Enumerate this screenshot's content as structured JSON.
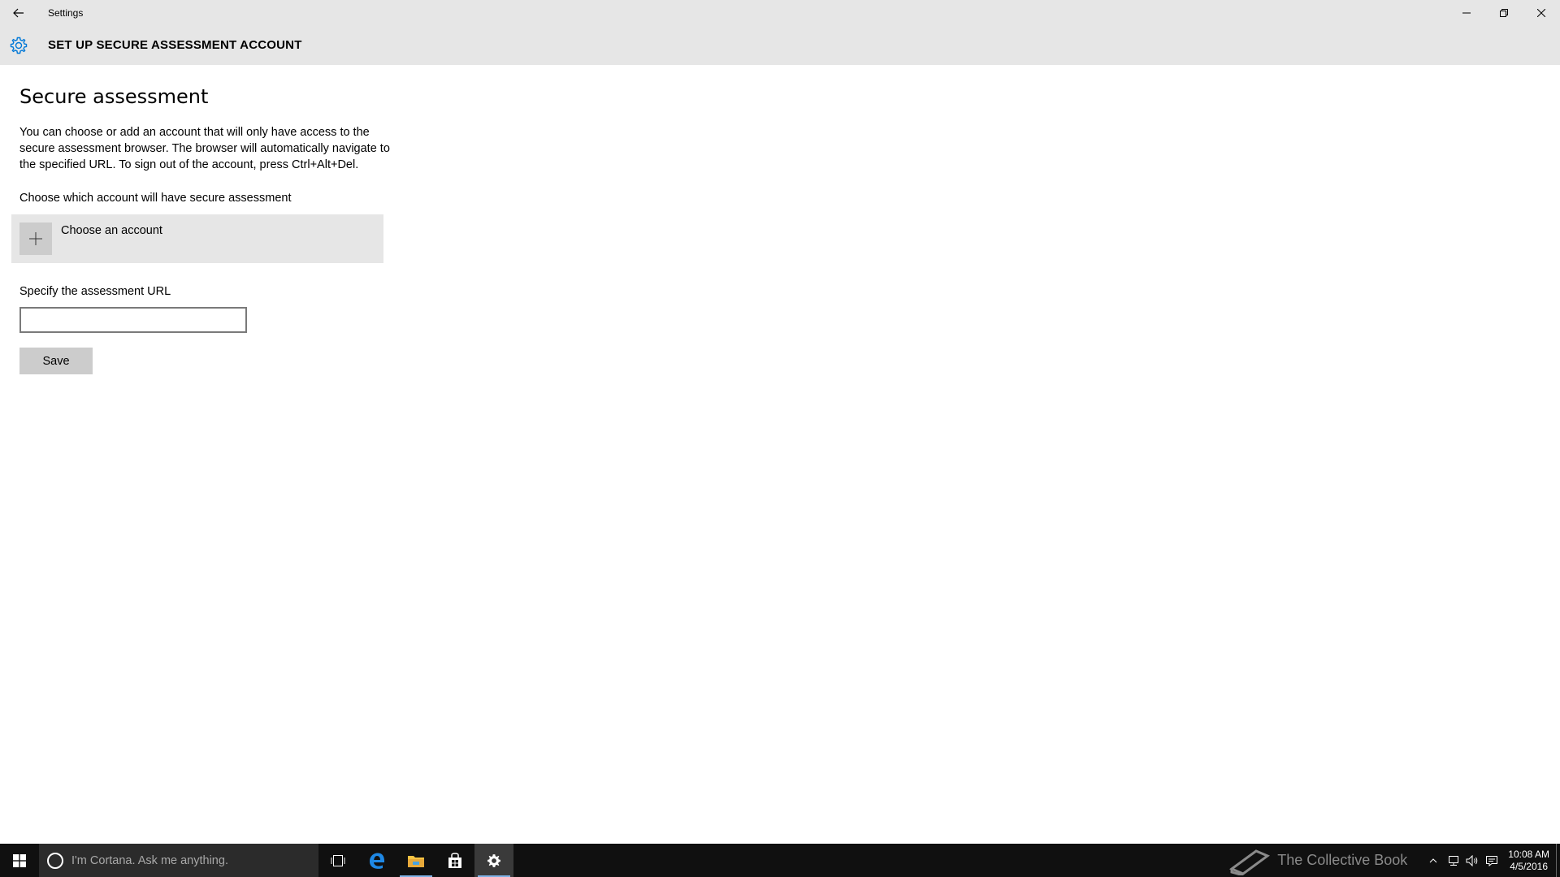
{
  "window": {
    "title": "Settings"
  },
  "header": {
    "title": "SET UP SECURE ASSESSMENT ACCOUNT"
  },
  "content": {
    "page_title": "Secure assessment",
    "description": "You can choose or add an account that will only have access to the secure assessment browser. The browser will automatically navigate to the specified URL. To sign out of the account, press Ctrl+Alt+Del.",
    "account_section_label": "Choose which account will have secure assessment",
    "account_tile_label": "Choose an account",
    "url_label": "Specify the assessment URL",
    "url_value": "",
    "save_label": "Save"
  },
  "taskbar": {
    "search_placeholder": "I'm Cortana. Ask me anything.",
    "watermark": "The Collective Book",
    "clock_time": "10:08 AM",
    "clock_date": "4/5/2016"
  },
  "colors": {
    "accent": "#0078d7",
    "titlebar_bg": "#e6e6e6",
    "taskbar_bg": "#101010"
  },
  "icons": [
    "back-arrow-icon",
    "minimize-icon",
    "restore-icon",
    "close-icon",
    "gear-icon",
    "plus-icon",
    "windows-start-icon",
    "cortana-icon",
    "task-view-icon",
    "edge-icon",
    "file-explorer-icon",
    "store-icon",
    "settings-icon",
    "book-icon",
    "chevron-up-icon",
    "network-icon",
    "volume-icon",
    "action-center-icon"
  ]
}
